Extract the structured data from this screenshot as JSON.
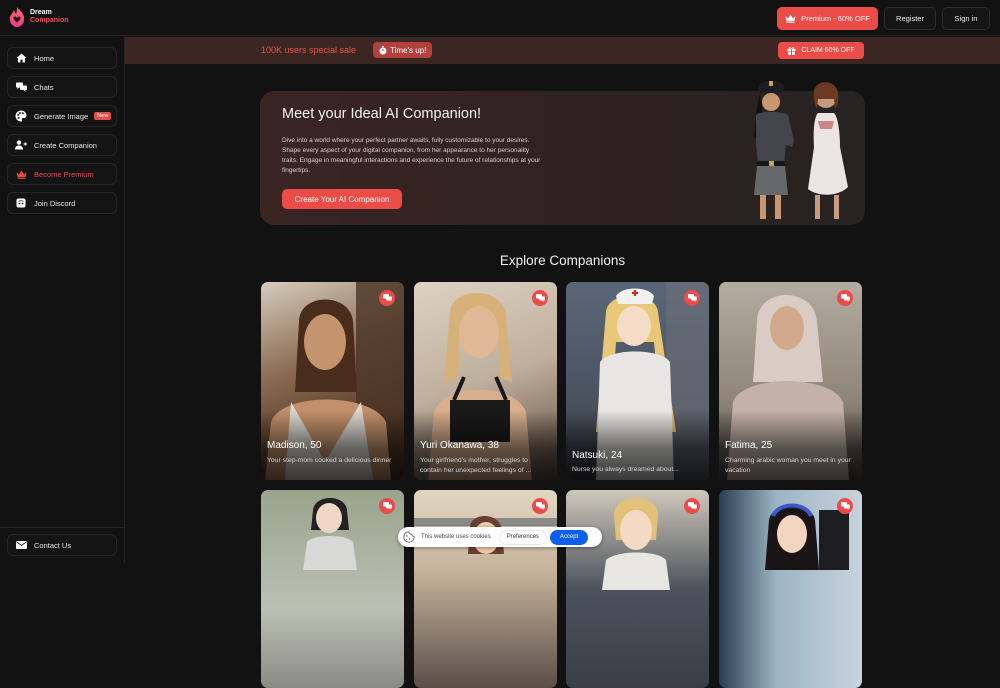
{
  "brand": {
    "line1": "Dream",
    "line2": "Companion"
  },
  "header": {
    "premium_label": "Premium - 60% OFF",
    "register_label": "Register",
    "signin_label": "Sign in"
  },
  "sidebar": {
    "items": [
      {
        "label": "Home",
        "icon": "home-icon"
      },
      {
        "label": "Chats",
        "icon": "chats-icon"
      },
      {
        "label": "Generate Image",
        "icon": "palette-icon",
        "badge": "New"
      },
      {
        "label": "Create Companion",
        "icon": "add-user-icon"
      },
      {
        "label": "Become Premium",
        "icon": "crown-icon"
      },
      {
        "label": "Join Discord",
        "icon": "discord-icon"
      }
    ],
    "footer_item": {
      "label": "Contact Us",
      "icon": "envelope-icon"
    }
  },
  "promo": {
    "text": "100K users special sale",
    "timer_label": "Time's up!",
    "claim_label": "CLAIM 60% OFF"
  },
  "hero": {
    "title": "Meet your Ideal AI Companion!",
    "description": "Dive into a world where your perfect partner awaits, fully customizable to your desires. Shape every aspect of your digital companion, from her appearance to her personality traits. Engage in meaningful interactions and experience the future of relationships at your fingertips.",
    "cta_label": "Create Your AI Companion"
  },
  "explore": {
    "title": "Explore Companions",
    "cards": [
      {
        "name": "Madison, 50",
        "description": "Your step-mom cooked a delicious dinner"
      },
      {
        "name": "Yuri Okanawa, 38",
        "description": "Your girlfriend's mother, struggles to contain her unexpected feelings of ..."
      },
      {
        "name": "Natsuki, 24",
        "description": "Nurse you always dreamed about..."
      },
      {
        "name": "Fatima, 25",
        "description": "Charming arabic woman you meet in your vacation"
      }
    ]
  },
  "cookie": {
    "text": "This website uses cookies",
    "preferences_label": "Preferences",
    "accept_label": "Accept"
  },
  "colors": {
    "accent": "#ec4c48",
    "promo_bg": "#3c2624",
    "accept_blue": "#0b5ef0",
    "background": "#121212"
  }
}
